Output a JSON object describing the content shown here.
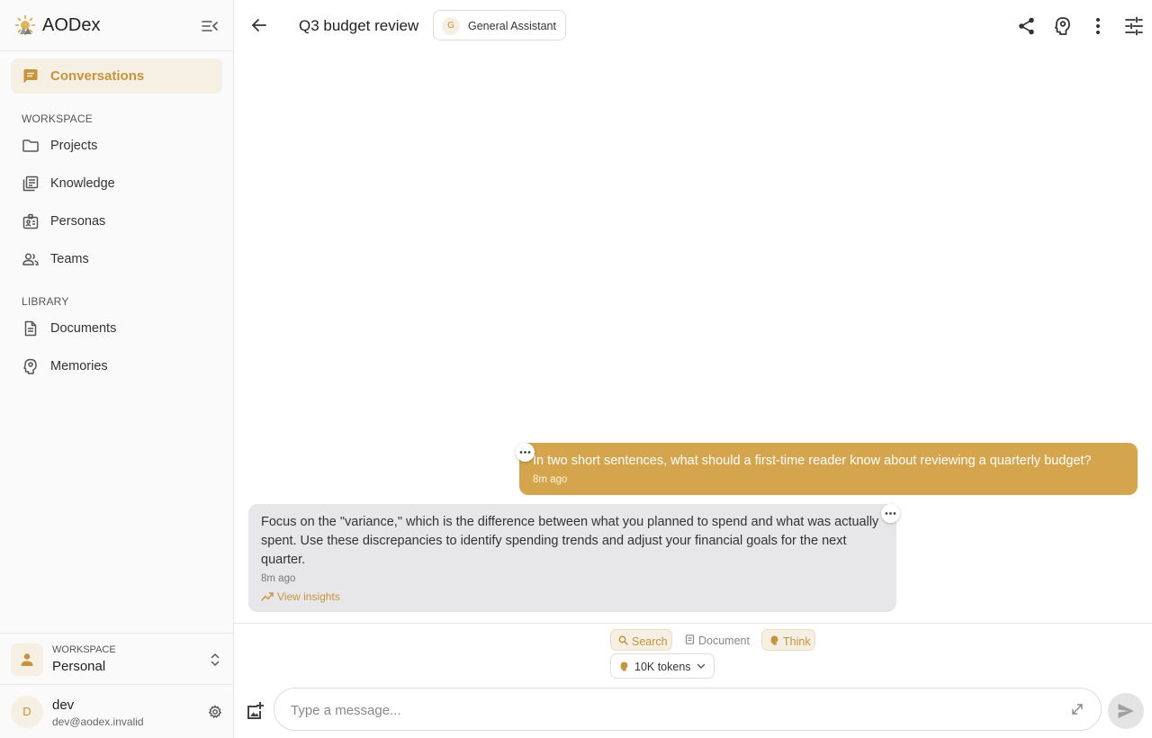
{
  "app": {
    "name": "AODex"
  },
  "sidebar": {
    "active_item": {
      "label": "Conversations"
    },
    "workspace_section": "WORKSPACE",
    "workspace_items": [
      {
        "label": "Projects",
        "icon": "folder-icon"
      },
      {
        "label": "Knowledge",
        "icon": "library-icon"
      },
      {
        "label": "Personas",
        "icon": "badge-icon"
      },
      {
        "label": "Teams",
        "icon": "people-icon"
      }
    ],
    "library_section": "LIBRARY",
    "library_items": [
      {
        "label": "Documents",
        "icon": "document-icon"
      },
      {
        "label": "Memories",
        "icon": "brain-icon"
      }
    ],
    "workspace_switcher": {
      "caption": "WORKSPACE",
      "value": "Personal"
    },
    "user": {
      "initial": "D",
      "name": "dev",
      "email": "dev@aodex.invalid"
    }
  },
  "header": {
    "title": "Q3 budget review",
    "persona": {
      "initial": "G",
      "label": "General Assistant"
    }
  },
  "messages": {
    "user": {
      "text": "In two short sentences, what should a first-time reader know about reviewing a quarterly budget?",
      "time": "8m ago"
    },
    "assistant": {
      "text": "Focus on the \"variance,\" which is the difference between what you planned to spend and what was actually spent. Use these discrepancies to identify spending trends and adjust your financial goals for the next quarter.",
      "time": "8m ago",
      "insights_label": "View insights"
    }
  },
  "composer": {
    "tools": {
      "search": "Search",
      "document": "Document",
      "think": "Think"
    },
    "tokens_label": "10K tokens",
    "placeholder": "Type a message..."
  },
  "colors": {
    "accent": "#c8933b",
    "user_bubble": "#d4a54d",
    "assistant_bubble": "#e7e7e9"
  }
}
